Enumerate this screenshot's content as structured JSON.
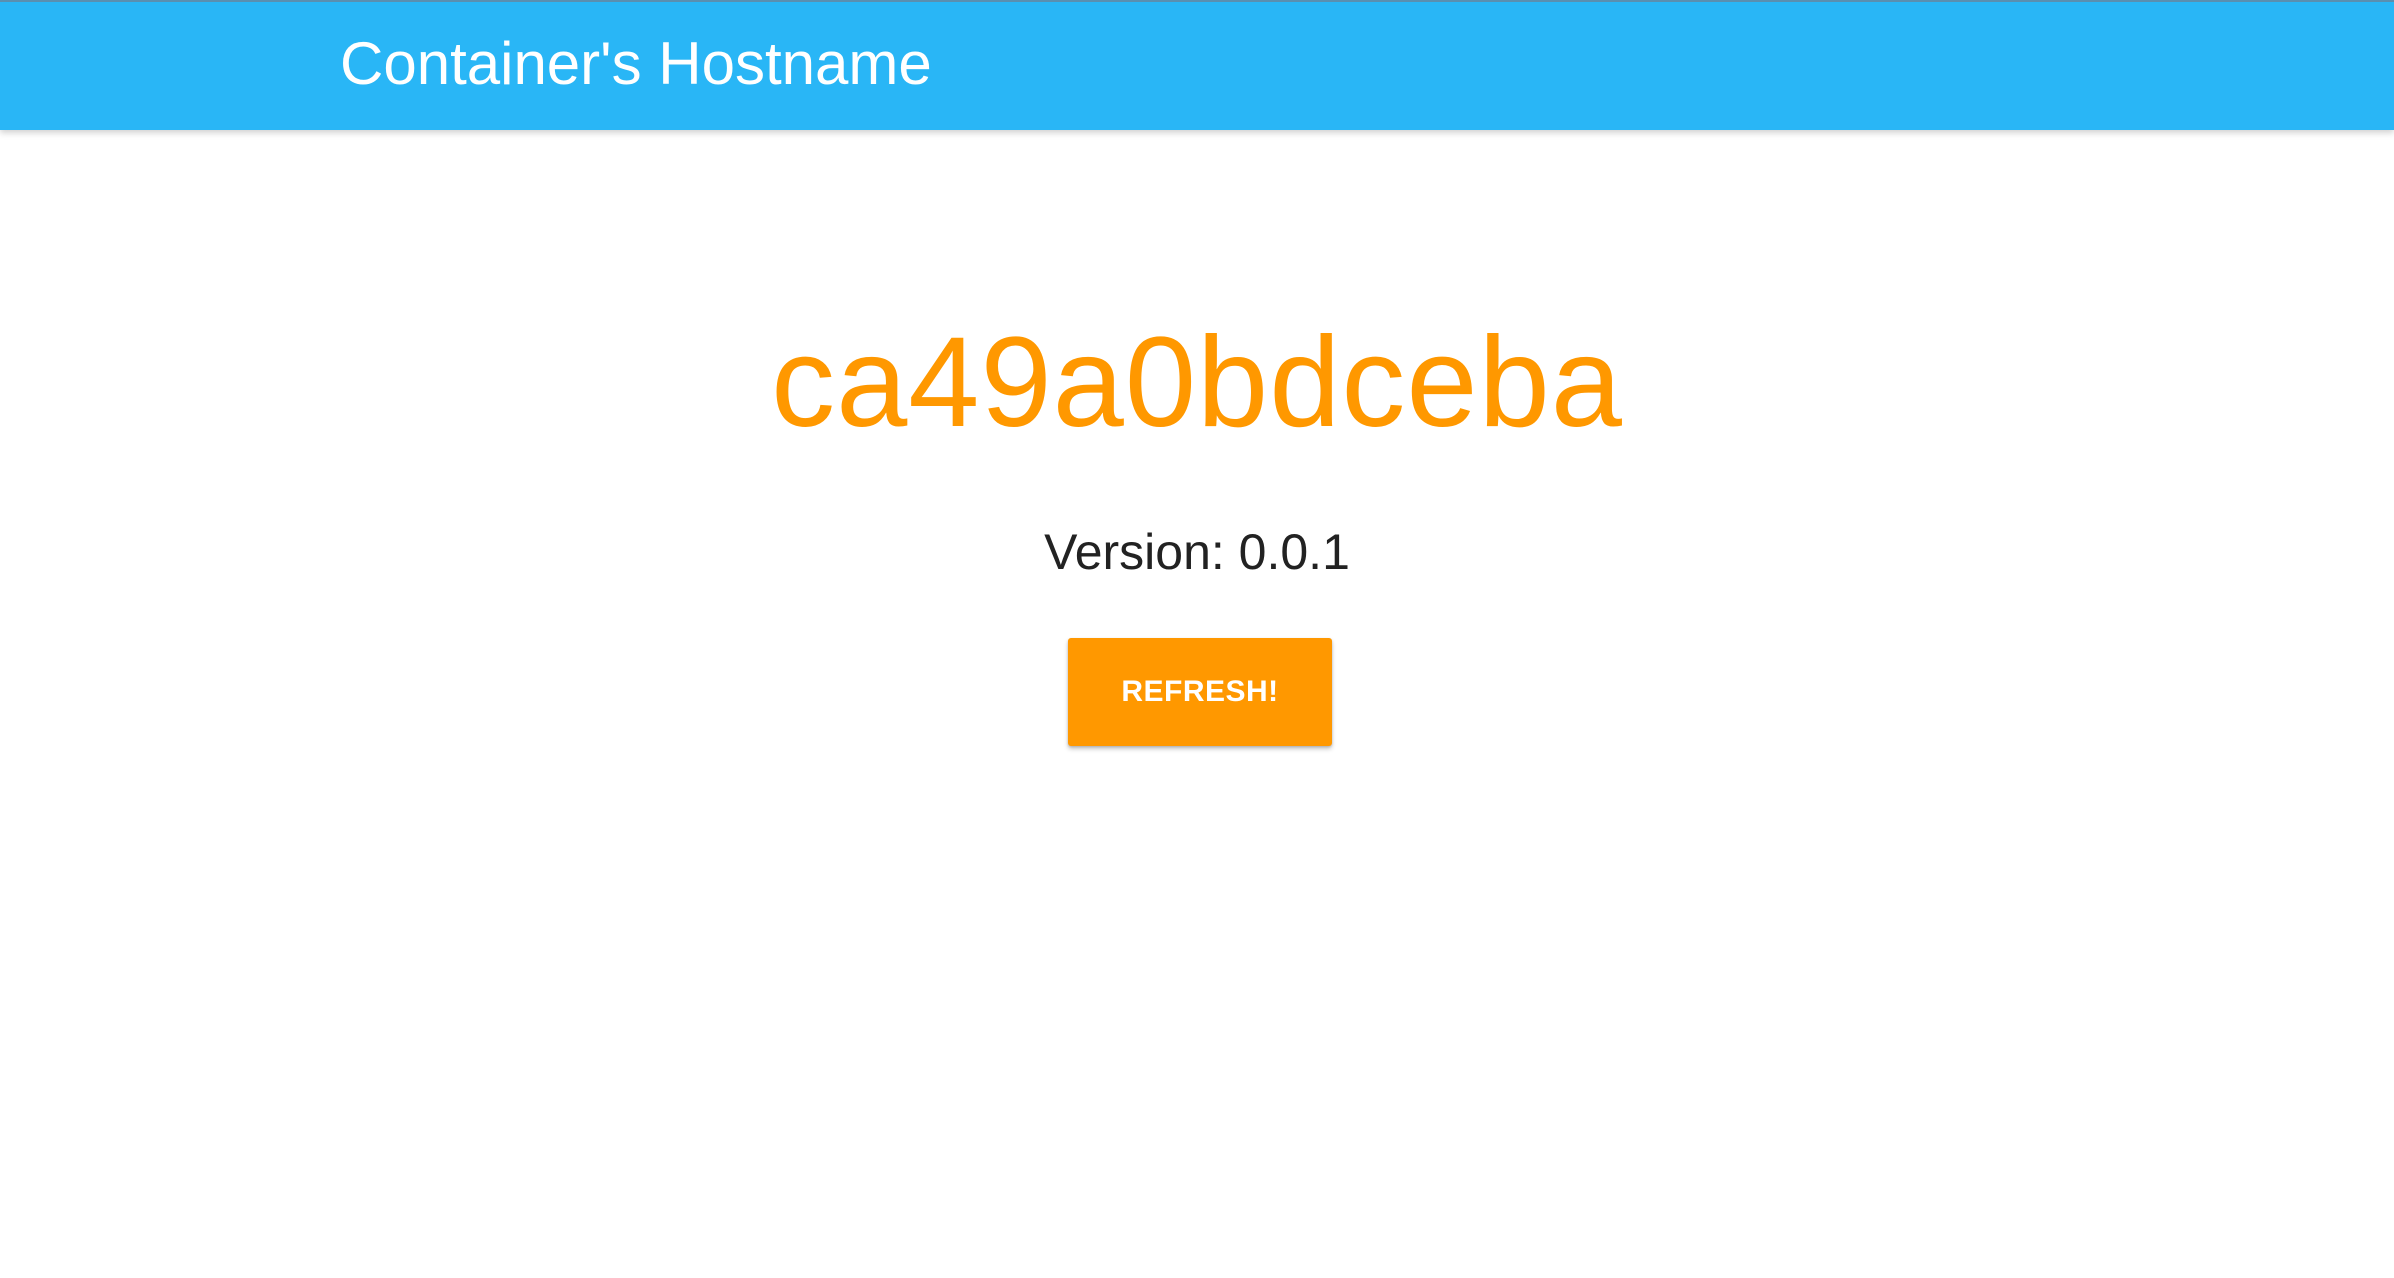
{
  "header": {
    "title": "Container's Hostname"
  },
  "main": {
    "hostname": "ca49a0bdceba",
    "version_text": "Version: 0.0.1",
    "refresh_label": "REFRESH!"
  },
  "colors": {
    "appbar": "#29b6f6",
    "accent": "#ff9800",
    "text": "#222222",
    "background": "#ffffff"
  }
}
